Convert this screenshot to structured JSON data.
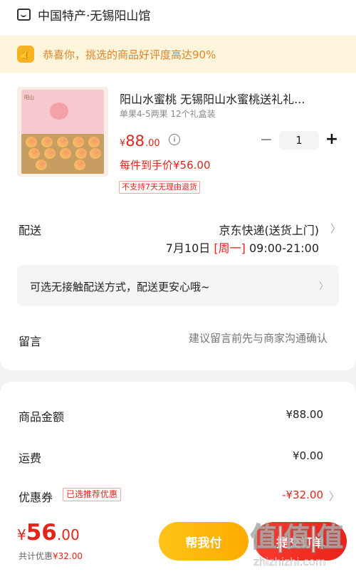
{
  "shop": {
    "icon": "shop-icon",
    "name": "中国特产·无锡阳山馆"
  },
  "banner": {
    "icon": "thumbs-up-icon",
    "text": "恭喜你，挑选的商品好评度高达90%"
  },
  "product": {
    "image_alt": "peach gift box",
    "box_logo": "阳山",
    "title": "阳山水蜜桃 无锡阳山水蜜桃送礼礼...",
    "spec": "单果4-5两果 12个礼盒装",
    "price_symbol": "¥",
    "price_main": "88",
    "price_decimal": ".00",
    "info_icon": "info-icon",
    "quantity": "1",
    "minus": "−",
    "plus": "+",
    "net_price": "每件到手价¥56.00",
    "return_policy": "不支持7天无理由退货"
  },
  "delivery": {
    "label": "配送",
    "method": "京东快递(送货上门)",
    "date": "7月10日",
    "weekday": "[周一]",
    "time": "09:00-21:00",
    "contactless": "可选无接触配送方式，配送更安心哦~"
  },
  "note": {
    "label": "留言",
    "placeholder": "建议留言前先与商家沟通确认"
  },
  "summary": {
    "goods_label": "商品金额",
    "goods_value": "¥88.00",
    "shipping_label": "运费",
    "shipping_value": "¥0.00",
    "coupon_label": "优惠券",
    "coupon_tag": "已选推荐优惠",
    "coupon_value": "-¥32.00"
  },
  "footer": {
    "total_symbol": "¥",
    "total_main": "56",
    "total_decimal": ".00",
    "saving_label": "共计优惠",
    "saving_value": "¥32.00",
    "help_pay": "帮我付",
    "pay": "提交订单"
  },
  "watermark": {
    "logo": "值|值|值",
    "url": "zhizhizhi.com"
  },
  "colors": {
    "accent_red": "#e1251b",
    "banner_bg": "#fdf4dc",
    "banner_text": "#e0862a",
    "help_pay": "#ffb300"
  }
}
